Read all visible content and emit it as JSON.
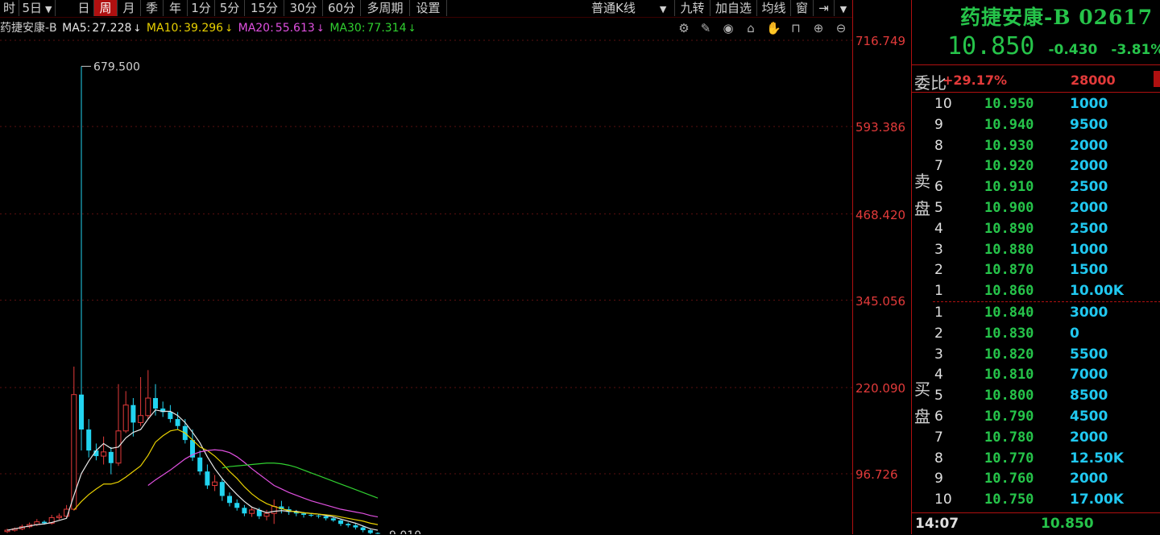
{
  "toolbar": {
    "items": [
      "时",
      "5日",
      "日",
      "周",
      "月",
      "季",
      "年",
      "1分",
      "5分",
      "15分",
      "30分",
      "60分",
      "多周期",
      "设置"
    ],
    "active": "周",
    "kline_type": "普通K线",
    "right_items": [
      "九转",
      "加自选",
      "均线",
      "窗"
    ]
  },
  "indicator": {
    "stock": "药捷安康-B",
    "ma5_label": "MA5:",
    "ma5": "27.228",
    "ma10_label": "MA10:",
    "ma10": "39.296",
    "ma20_label": "MA20:",
    "ma20": "55.613",
    "ma30_label": "MA30:",
    "ma30": "77.314",
    "arrow": "↓"
  },
  "tool_icons": [
    "settings-icon",
    "brush-icon",
    "eye-icon",
    "basket-icon",
    "hand-icon",
    "lock-icon",
    "zoom-in-icon",
    "zoom-out-icon"
  ],
  "axis": {
    "labels": [
      "716.749",
      "593.386",
      "468.420",
      "345.056",
      "220.090",
      "96.726"
    ]
  },
  "chart_data": {
    "type": "candlestick",
    "ylim": [
      0,
      716.749
    ],
    "annotations": [
      {
        "text": "679.500",
        "value": 679.5
      },
      {
        "text": "9.010",
        "value": 9.01
      }
    ],
    "candles": [
      {
        "o": 14,
        "c": 16,
        "h": 18,
        "l": 12
      },
      {
        "o": 16,
        "c": 18,
        "h": 20,
        "l": 14
      },
      {
        "o": 18,
        "c": 21,
        "h": 24,
        "l": 16
      },
      {
        "o": 21,
        "c": 24,
        "h": 27,
        "l": 19
      },
      {
        "o": 24,
        "c": 28,
        "h": 32,
        "l": 22
      },
      {
        "o": 28,
        "c": 26,
        "h": 30,
        "l": 24
      },
      {
        "o": 26,
        "c": 34,
        "h": 38,
        "l": 24
      },
      {
        "o": 34,
        "c": 36,
        "h": 40,
        "l": 31
      },
      {
        "o": 36,
        "c": 46,
        "h": 52,
        "l": 34
      },
      {
        "o": 46,
        "c": 210,
        "h": 250,
        "l": 44
      },
      {
        "o": 210,
        "c": 160,
        "h": 679.5,
        "l": 130
      },
      {
        "o": 160,
        "c": 130,
        "h": 175,
        "l": 120
      },
      {
        "o": 130,
        "c": 122,
        "h": 140,
        "l": 116
      },
      {
        "o": 122,
        "c": 128,
        "h": 150,
        "l": 110
      },
      {
        "o": 128,
        "c": 112,
        "h": 135,
        "l": 96
      },
      {
        "o": 112,
        "c": 158,
        "h": 225,
        "l": 108
      },
      {
        "o": 158,
        "c": 195,
        "h": 215,
        "l": 155
      },
      {
        "o": 195,
        "c": 170,
        "h": 205,
        "l": 150
      },
      {
        "o": 170,
        "c": 180,
        "h": 235,
        "l": 165
      },
      {
        "o": 180,
        "c": 205,
        "h": 245,
        "l": 175
      },
      {
        "o": 205,
        "c": 190,
        "h": 225,
        "l": 180
      },
      {
        "o": 190,
        "c": 185,
        "h": 200,
        "l": 178
      },
      {
        "o": 185,
        "c": 175,
        "h": 195,
        "l": 170
      },
      {
        "o": 175,
        "c": 165,
        "h": 185,
        "l": 160
      },
      {
        "o": 165,
        "c": 145,
        "h": 175,
        "l": 140
      },
      {
        "o": 145,
        "c": 120,
        "h": 160,
        "l": 115
      },
      {
        "o": 120,
        "c": 100,
        "h": 130,
        "l": 95
      },
      {
        "o": 100,
        "c": 80,
        "h": 110,
        "l": 75
      },
      {
        "o": 80,
        "c": 85,
        "h": 95,
        "l": 72
      },
      {
        "o": 85,
        "c": 65,
        "h": 90,
        "l": 58
      },
      {
        "o": 65,
        "c": 55,
        "h": 70,
        "l": 50
      },
      {
        "o": 55,
        "c": 48,
        "h": 60,
        "l": 44
      },
      {
        "o": 48,
        "c": 40,
        "h": 52,
        "l": 36
      },
      {
        "o": 40,
        "c": 45,
        "h": 50,
        "l": 35
      },
      {
        "o": 45,
        "c": 36,
        "h": 48,
        "l": 32
      },
      {
        "o": 36,
        "c": 40,
        "h": 45,
        "l": 30
      },
      {
        "o": 40,
        "c": 50,
        "h": 60,
        "l": 25
      },
      {
        "o": 50,
        "c": 46,
        "h": 58,
        "l": 40
      },
      {
        "o": 46,
        "c": 42,
        "h": 50,
        "l": 38
      },
      {
        "o": 42,
        "c": 40,
        "h": 45,
        "l": 36
      },
      {
        "o": 40,
        "c": 38,
        "h": 42,
        "l": 34
      },
      {
        "o": 38,
        "c": 37,
        "h": 40,
        "l": 35
      },
      {
        "o": 37,
        "c": 36,
        "h": 39,
        "l": 33
      },
      {
        "o": 36,
        "c": 33,
        "h": 38,
        "l": 30
      },
      {
        "o": 33,
        "c": 30,
        "h": 35,
        "l": 28
      },
      {
        "o": 30,
        "c": 25,
        "h": 32,
        "l": 22
      },
      {
        "o": 25,
        "c": 23,
        "h": 27,
        "l": 20
      },
      {
        "o": 23,
        "c": 20,
        "h": 25,
        "l": 17
      },
      {
        "o": 20,
        "c": 16,
        "h": 22,
        "l": 13
      },
      {
        "o": 16,
        "c": 12,
        "h": 18,
        "l": 10
      },
      {
        "o": 12,
        "c": 11,
        "h": 13,
        "l": 9.01
      }
    ],
    "ma5": [
      16,
      18,
      20,
      22,
      24,
      25,
      27,
      30,
      33,
      66,
      97,
      115,
      130,
      140,
      133,
      135,
      148,
      156,
      160,
      175,
      188,
      186,
      186,
      180,
      170,
      156,
      141,
      121,
      104,
      90,
      78,
      67,
      57,
      49,
      45,
      41,
      43,
      44,
      43,
      43,
      41,
      40,
      39,
      37,
      35,
      32,
      29,
      26,
      22,
      18,
      16
    ],
    "ma10": [
      null,
      null,
      null,
      null,
      null,
      null,
      null,
      null,
      null,
      45,
      57,
      67,
      75,
      82,
      82,
      85,
      92,
      100,
      108,
      123,
      142,
      151,
      158,
      160,
      155,
      145,
      135,
      130,
      122,
      112,
      100,
      90,
      78,
      68,
      60,
      54,
      50,
      47,
      44,
      42,
      41,
      40,
      39,
      38,
      37,
      35,
      33,
      31,
      29,
      26,
      24
    ],
    "ma20": [
      null,
      null,
      null,
      null,
      null,
      null,
      null,
      null,
      null,
      null,
      null,
      null,
      null,
      null,
      null,
      null,
      null,
      null,
      null,
      80,
      88,
      95,
      102,
      110,
      118,
      124,
      128,
      130,
      131,
      130,
      127,
      121,
      113,
      104,
      96,
      88,
      80,
      75,
      70,
      66,
      62,
      58,
      55,
      52,
      49,
      46,
      44,
      42,
      40,
      37,
      35
    ],
    "ma30": [
      null,
      null,
      null,
      null,
      null,
      null,
      null,
      null,
      null,
      null,
      null,
      null,
      null,
      null,
      null,
      null,
      null,
      null,
      null,
      null,
      null,
      null,
      null,
      null,
      null,
      null,
      null,
      null,
      null,
      105,
      107,
      108,
      109,
      110,
      111,
      112,
      112,
      111,
      109,
      106,
      102,
      98,
      94,
      90,
      86,
      82,
      78,
      74,
      70,
      66,
      62
    ]
  },
  "quote": {
    "title": "药捷安康-B 02617",
    "price": "10.850",
    "change": "-0.430",
    "change_pct": "-3.81%",
    "weibi_label": "委比",
    "weibi_val": "+29.17%",
    "weibi_num": "28000",
    "sell_label": "卖盘",
    "buy_label": "买盘",
    "sells": [
      {
        "lvl": "10",
        "price": "10.950",
        "vol": "1000"
      },
      {
        "lvl": "9",
        "price": "10.940",
        "vol": "9500"
      },
      {
        "lvl": "8",
        "price": "10.930",
        "vol": "2000"
      },
      {
        "lvl": "7",
        "price": "10.920",
        "vol": "2000"
      },
      {
        "lvl": "6",
        "price": "10.910",
        "vol": "2500"
      },
      {
        "lvl": "5",
        "price": "10.900",
        "vol": "2000"
      },
      {
        "lvl": "4",
        "price": "10.890",
        "vol": "2500"
      },
      {
        "lvl": "3",
        "price": "10.880",
        "vol": "1000"
      },
      {
        "lvl": "2",
        "price": "10.870",
        "vol": "1500"
      },
      {
        "lvl": "1",
        "price": "10.860",
        "vol": "10.00K"
      }
    ],
    "buys": [
      {
        "lvl": "1",
        "price": "10.840",
        "vol": "3000"
      },
      {
        "lvl": "2",
        "price": "10.830",
        "vol": "0"
      },
      {
        "lvl": "3",
        "price": "10.820",
        "vol": "5500"
      },
      {
        "lvl": "4",
        "price": "10.810",
        "vol": "7000"
      },
      {
        "lvl": "5",
        "price": "10.800",
        "vol": "8500"
      },
      {
        "lvl": "6",
        "price": "10.790",
        "vol": "4500"
      },
      {
        "lvl": "7",
        "price": "10.780",
        "vol": "2000"
      },
      {
        "lvl": "8",
        "price": "10.770",
        "vol": "12.50K"
      },
      {
        "lvl": "9",
        "price": "10.760",
        "vol": "2000"
      },
      {
        "lvl": "10",
        "price": "10.750",
        "vol": "17.00K"
      }
    ],
    "time": "14:07",
    "time_price": "10.850"
  },
  "colors": {
    "up": "#e23a3a",
    "down": "#22d4f0",
    "accent": "#b01010",
    "green": "#26c44a"
  }
}
